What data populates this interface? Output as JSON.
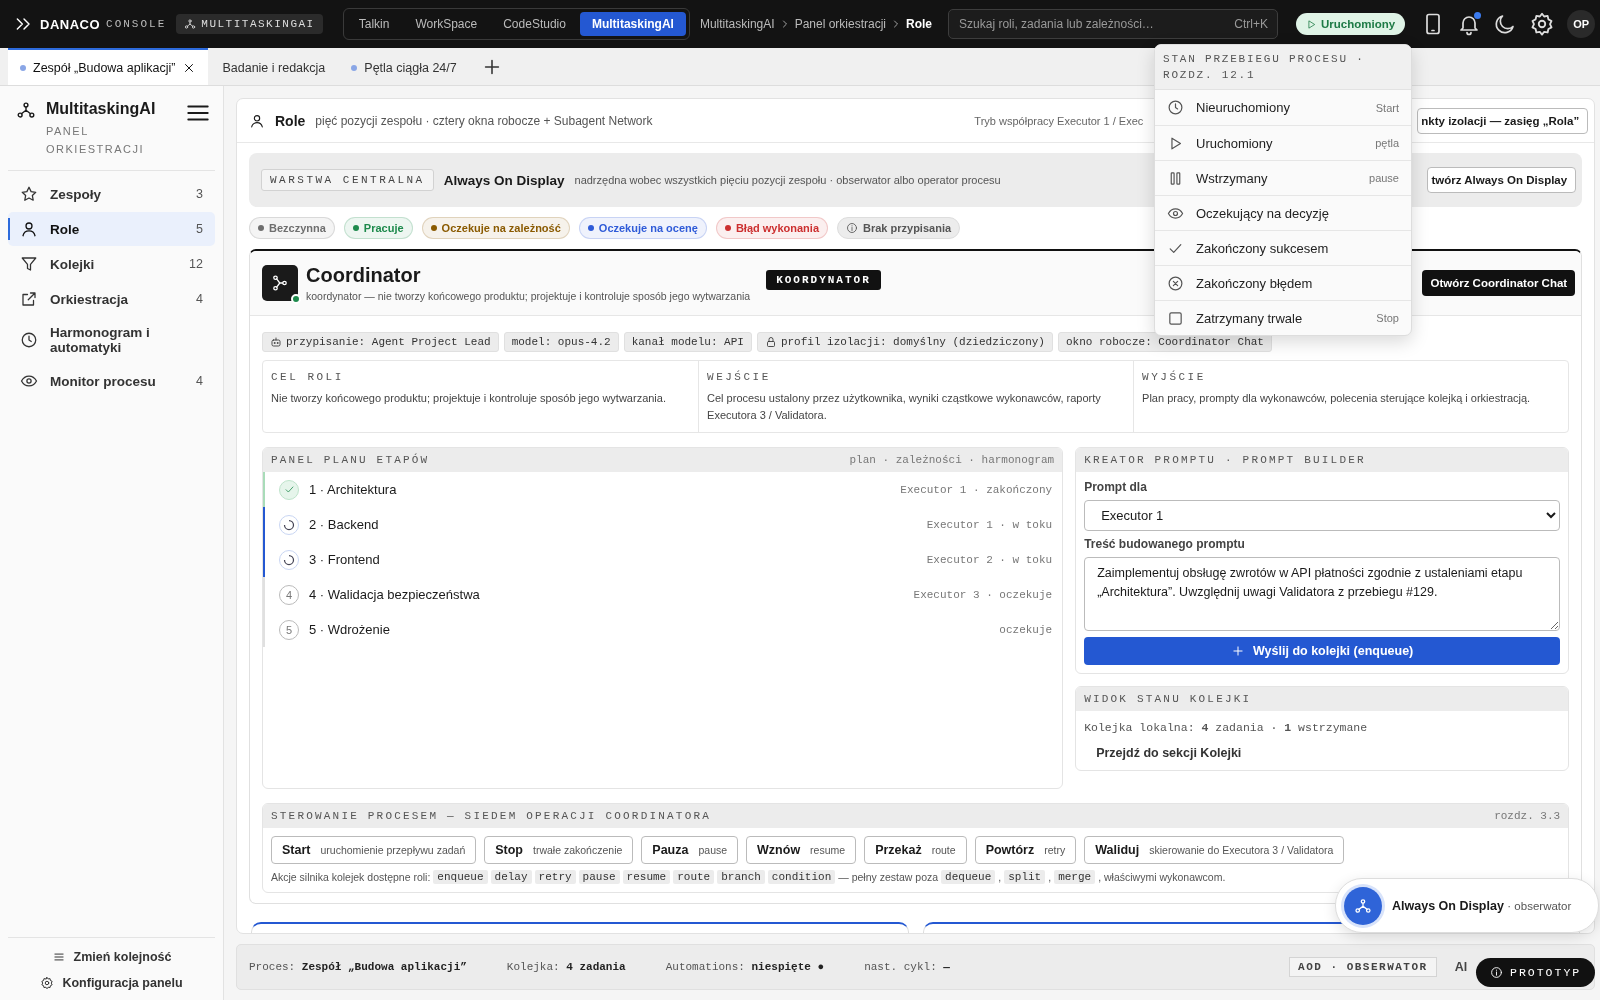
{
  "brand": {
    "name": "DANACO",
    "suffix": "CONSOLE",
    "workspace": "MULTITASKINGAI"
  },
  "apps": [
    {
      "label": "Talkin",
      "selected": false
    },
    {
      "label": "WorkSpace",
      "selected": false
    },
    {
      "label": "CodeStudio",
      "selected": false
    },
    {
      "label": "MultitaskingAI",
      "selected": true
    }
  ],
  "breadcrumb": [
    "MultitaskingAI",
    "Panel orkiestracji",
    "Role"
  ],
  "search": {
    "placeholder": "Szukaj roli, zadania lub zależności…",
    "shortcut": "Ctrl+K"
  },
  "run_status": {
    "label": "Uruchomiony"
  },
  "notifications": {
    "unread": true
  },
  "user": {
    "initials": "OP"
  },
  "doc_tabs": [
    {
      "label": "Zespół „Budowa aplikacji”",
      "selected": true,
      "indicator": true,
      "closable": true
    },
    {
      "label": "Badanie i redakcja",
      "selected": false,
      "indicator": false,
      "closable": false
    },
    {
      "label": "Pętla ciągła 24/7",
      "selected": false,
      "indicator": true,
      "closable": false
    }
  ],
  "sidebar": {
    "title": "MultitaskingAI",
    "subtitle": "PANEL ORKIESTRACJI",
    "items": [
      {
        "label": "Zespoły",
        "count": "3",
        "selected": false
      },
      {
        "label": "Role",
        "count": "5",
        "selected": true
      },
      {
        "label": "Kolejki",
        "count": "12",
        "selected": false
      },
      {
        "label": "Orkiestracja",
        "count": "4",
        "selected": false
      },
      {
        "label": "Harmonogram i automatyki",
        "selected": false
      },
      {
        "label": "Monitor procesu",
        "count": "4",
        "selected": false
      }
    ],
    "footer": [
      "Zmień kolejność",
      "Konfiguracja panelu"
    ]
  },
  "role_header": {
    "title": "Role",
    "subtitle": "pięć pozycji zespołu · cztery okna robocze + Subagent Network",
    "mode": "Tryb współpracy Executor 1 / Exec",
    "button": "nkty izolacji — zasięg „Rola”"
  },
  "central_layer": {
    "tag": "WARSTWA CENTRALNA",
    "title": "Always On Display",
    "description": "nadrzędna wobec wszystkich pięciu pozycji zespołu · obserwator albo operator procesu",
    "button": "twórz Always On Display"
  },
  "legend": [
    {
      "label": "Bezczynna",
      "kind": "dot",
      "color": "#6e6e6e"
    },
    {
      "label": "Pracuje",
      "kind": "dot",
      "color": "#1d8a4c"
    },
    {
      "label": "Oczekuje na zależność",
      "kind": "dot",
      "color": "#8a5a00"
    },
    {
      "label": "Oczekuje na ocenę",
      "kind": "dot",
      "color": "#2f5bd8"
    },
    {
      "label": "Błąd wykonania",
      "kind": "dot",
      "color": "#cc2f2f"
    },
    {
      "label": "Brak przypisania",
      "kind": "info"
    }
  ],
  "role": {
    "name": "Coordinator",
    "description": "koordynator — nie tworzy końcowego produktu; projektuje i kontroluje sposób jego wytwarzania",
    "online": true,
    "badge": "KOORDYNATOR",
    "button": "Otwórz Coordinator Chat",
    "chips": [
      {
        "label": "przypisanie: Agent Project Lead",
        "kind": "agent"
      },
      {
        "label": "model: opus-4.2",
        "kind": "plain"
      },
      {
        "label": "kanał modelu: API",
        "kind": "plain"
      },
      {
        "label": "profil izolacji: domyślny (dziedziczony)",
        "kind": "lock"
      },
      {
        "label": "okno robocze: Coordinator Chat",
        "kind": "plain"
      }
    ],
    "columns": [
      {
        "heading": "CEL ROLI",
        "text": "Nie tworzy końcowego produktu; projektuje i kontroluje sposób jego wytwarzania."
      },
      {
        "heading": "WEJŚCIE",
        "text": "Cel procesu ustalony przez użytkownika, wyniki cząstkowe wykonawców, raporty Executora 3 / Validatora."
      },
      {
        "heading": "WYJŚCIE",
        "text": "Plan pracy, prompty dla wykonawców, polecenia sterujące kolejką i orkiestracją."
      }
    ]
  },
  "stages": {
    "title": "PANEL PLANU ETAPÓW",
    "meta": "plan · zależności · harmonogram",
    "items": [
      {
        "label": "1 · Architektura",
        "info": "Executor 1 · zakończony",
        "kind": "done"
      },
      {
        "label": "2 · Backend",
        "info": "Executor 1 · w toku",
        "kind": "active"
      },
      {
        "label": "3 · Frontend",
        "info": "Executor 2 · w toku",
        "kind": "active"
      },
      {
        "label": "4 · Walidacja bezpieczeństwa",
        "info": "Executor 3 · oczekuje",
        "kind": "pending",
        "marker": "4"
      },
      {
        "label": "5 · Wdrożenie",
        "info": "oczekuje",
        "kind": "pending",
        "marker": "5"
      }
    ]
  },
  "prompt_builder": {
    "title": "KREATOR PROMPTU · PROMPT BUILDER",
    "target_label": "Prompt dla",
    "target": "Executor 1",
    "body_label": "Treść budowanego promptu",
    "body": "Zaimplementuj obsługę zwrotów w API płatności zgodnie z ustaleniami etapu „Architektura”. Uwzględnij uwagi Validatora z przebiegu #129.",
    "submit": "Wyślij do kolejki (enqueue)"
  },
  "queue": {
    "title": "WIDOK STANU KOLEJKI",
    "summary": "Kolejka lokalna: **4** zadania · **1** wstrzymane",
    "link": "Przejdź do sekcji Kolejki"
  },
  "controls": {
    "title": "STEROWANIE PROCESEM — SIEDEM OPERACJI COORDINATORA",
    "ref": "rozdz. 3.3",
    "buttons": [
      {
        "label": "Start",
        "hint": "uruchomienie przepływu zadań"
      },
      {
        "label": "Stop",
        "hint": "trwałe zakończenie"
      },
      {
        "label": "Pauza",
        "hint": "pause"
      },
      {
        "label": "Wznów",
        "hint": "resume"
      },
      {
        "label": "Przekaż",
        "hint": "route"
      },
      {
        "label": "Powtórz",
        "hint": "retry"
      },
      {
        "label": "Waliduj",
        "hint": "skierowanie do Executora 3 / Validatora"
      }
    ],
    "note_prefix": "Akcje silnika kolejek dostępne roli:",
    "actions": [
      "enqueue",
      "delay",
      "retry",
      "pause",
      "resume",
      "route",
      "branch",
      "condition"
    ],
    "note_middle": "— pełny zestaw poza",
    "excluded": [
      "dequeue",
      "split",
      "merge"
    ],
    "separator": ",",
    "note_suffix": ", właściwymi wykonawcom."
  },
  "status_bar": {
    "items": [
      {
        "label": "Proces:",
        "value": "Zespół „Budowa aplikacji”"
      },
      {
        "label": "Kolejka:",
        "value": "4 zadania"
      },
      {
        "label": "Automations:",
        "value": "niespięte ●"
      },
      {
        "label": "nast. cykl:",
        "value": "—"
      }
    ],
    "badge": "AOD · OBSERWATOR",
    "extra": "Al"
  },
  "aod_widget": {
    "title": "Always On Display",
    "role": "· obserwator"
  },
  "prototype_badge": {
    "label": "PROTOTYP"
  },
  "status_menu": {
    "title": "STAN PRZEBIEGU PROCESU · ROZDZ. 12.1",
    "items": [
      {
        "label": "Nieuruchomiony",
        "hint": "Start"
      },
      {
        "label": "Uruchomiony",
        "hint": "pętla"
      },
      {
        "label": "Wstrzymany",
        "hint": "pause"
      },
      {
        "label": "Oczekujący na decyzję"
      },
      {
        "label": "Zakończony sukcesem"
      },
      {
        "label": "Zakończony błędem"
      },
      {
        "label": "Zatrzymany trwale",
        "hint": "Stop"
      }
    ]
  }
}
